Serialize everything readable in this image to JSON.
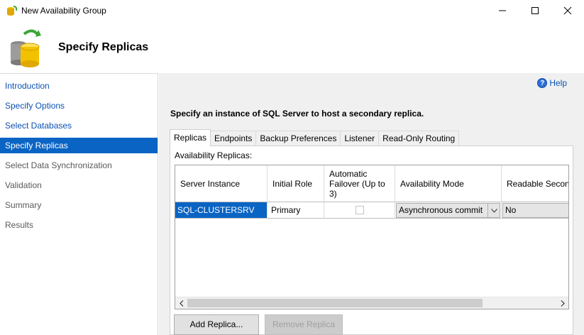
{
  "window": {
    "title": "New Availability Group",
    "icon": "availability-group-icon",
    "controls": {
      "minimize": "minimize-icon",
      "maximize": "maximize-icon",
      "close": "close-icon"
    }
  },
  "header": {
    "title": "Specify Replicas",
    "icon": "database-cylinder-sync-icon"
  },
  "nav": {
    "items": [
      {
        "label": "Introduction",
        "state": "link"
      },
      {
        "label": "Specify Options",
        "state": "link"
      },
      {
        "label": "Select Databases",
        "state": "link"
      },
      {
        "label": "Specify Replicas",
        "state": "selected"
      },
      {
        "label": "Select Data Synchronization",
        "state": "inactive"
      },
      {
        "label": "Validation",
        "state": "inactive"
      },
      {
        "label": "Summary",
        "state": "inactive"
      },
      {
        "label": "Results",
        "state": "inactive"
      }
    ]
  },
  "main": {
    "help_label": "Help",
    "instruction": "Specify an instance of SQL Server to host a secondary replica.",
    "tabs": [
      {
        "label": "Replicas",
        "active": true
      },
      {
        "label": "Endpoints",
        "active": false
      },
      {
        "label": "Backup Preferences",
        "active": false
      },
      {
        "label": "Listener",
        "active": false
      },
      {
        "label": "Read-Only Routing",
        "active": false
      }
    ],
    "panel_label": "Availability Replicas:",
    "grid": {
      "columns": [
        "Server Instance",
        "Initial Role",
        "Automatic Failover (Up to 3)",
        "Availability Mode",
        "Readable Second"
      ],
      "rows": [
        {
          "server_instance": "SQL-CLUSTERSRV",
          "initial_role": "Primary",
          "automatic_failover": false,
          "availability_mode": "Asynchronous commit",
          "readable_secondary": "No"
        }
      ]
    },
    "buttons": {
      "add_replica": "Add Replica...",
      "remove_replica": "Remove Replica"
    }
  },
  "colors": {
    "selection": "#0a64c4",
    "link": "#0b52b3",
    "panel_bg": "#f0f0f0"
  }
}
